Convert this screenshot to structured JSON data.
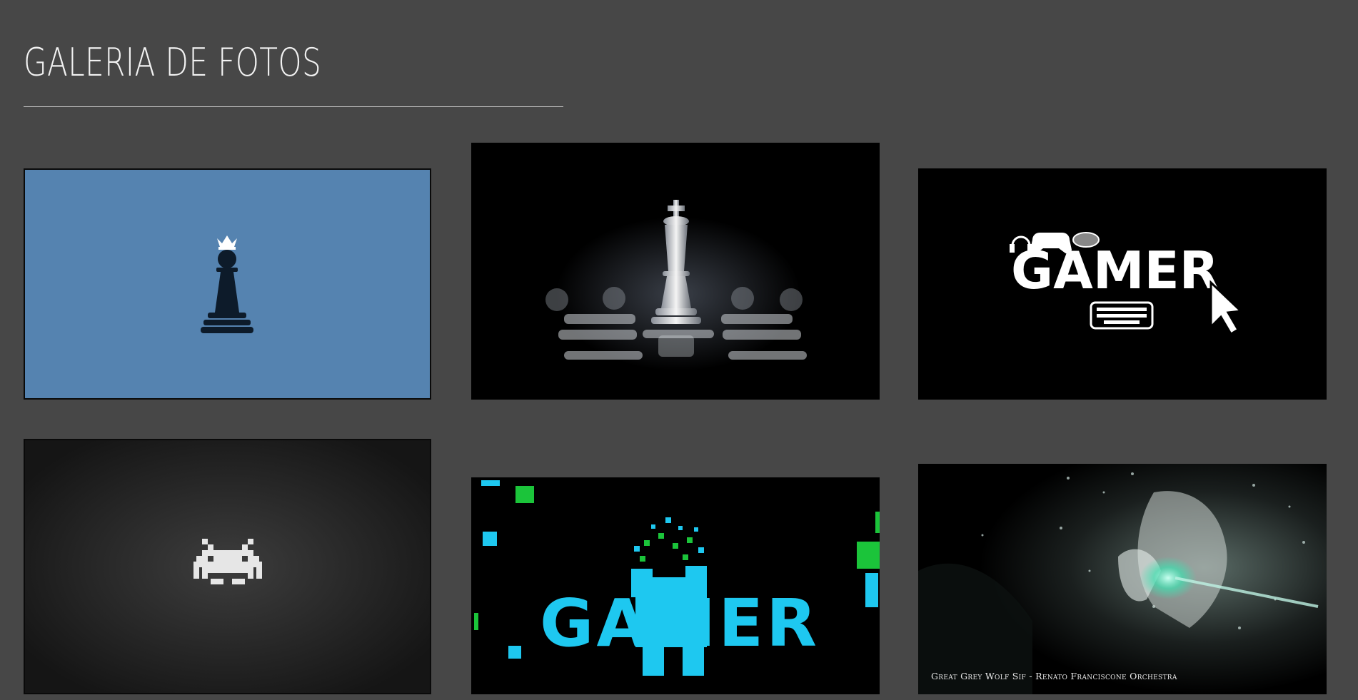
{
  "page": {
    "title": "GALERIA DE FOTOS"
  },
  "colors": {
    "background": "#474747",
    "title": "#f2f2f2",
    "divider": "#bdbdbd"
  },
  "gallery": {
    "photos": [
      {
        "subject": "pawn-with-crown",
        "background": "#5583b0"
      },
      {
        "subject": "chess-king"
      },
      {
        "subject": "gamer-logo",
        "text": "GAMER"
      },
      {
        "subject": "space-invader"
      },
      {
        "subject": "pixel-gamer-logo",
        "text": "GAMER"
      },
      {
        "subject": "wolf-artwork",
        "caption": "Great Grey Wolf Sif - Renato Franciscone Orchestra"
      }
    ]
  }
}
